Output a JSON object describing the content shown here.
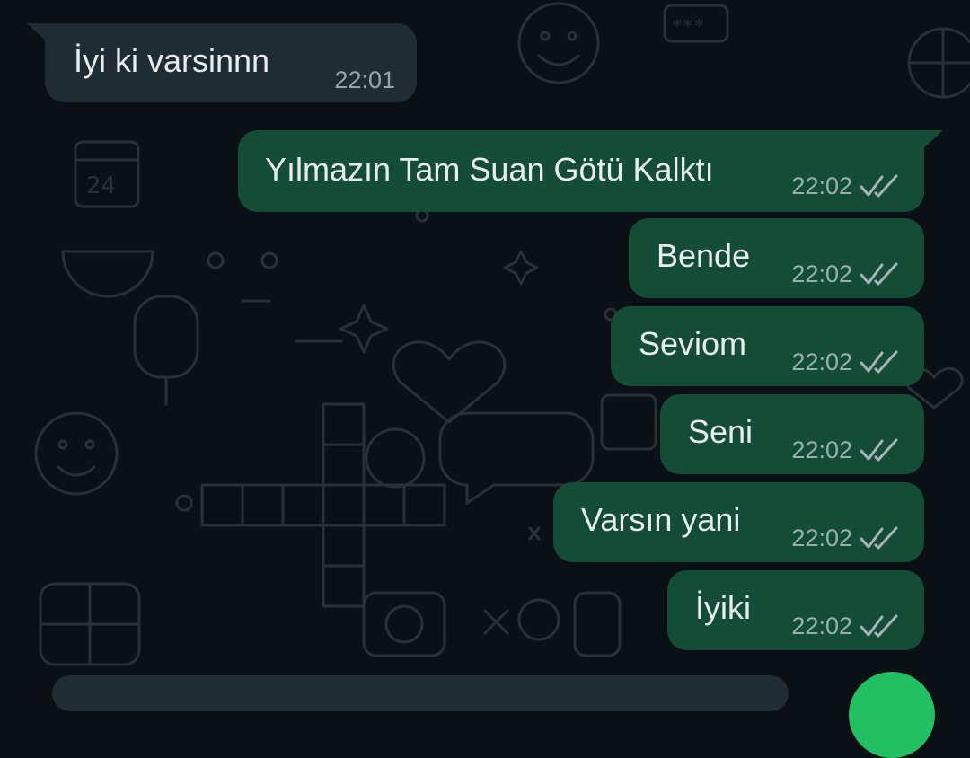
{
  "chat": {
    "messages": [
      {
        "direction": "incoming",
        "text": "İyi ki varsinnn",
        "time": "22:01"
      },
      {
        "direction": "outgoing",
        "text": "Yılmazın Tam Suan Götü Kalktı",
        "time": "22:02",
        "status": "read"
      },
      {
        "direction": "outgoing",
        "text": "Bende",
        "time": "22:02",
        "status": "read"
      },
      {
        "direction": "outgoing",
        "text": "Seviom",
        "time": "22:02",
        "status": "read"
      },
      {
        "direction": "outgoing",
        "text": "Seni",
        "time": "22:02",
        "status": "read"
      },
      {
        "direction": "outgoing",
        "text": "Varsın yani",
        "time": "22:02",
        "status": "read"
      },
      {
        "direction": "outgoing",
        "text": "İyiki",
        "time": "22:02",
        "status": "read"
      }
    ]
  },
  "theme": {
    "background": "#0b1014",
    "incoming_bubble": "#202c33",
    "outgoing_bubble": "#144d37",
    "text": "#e9edef",
    "send_button": "#21c063"
  },
  "icons": {
    "read_receipt": "double-check-icon",
    "send": "send-button"
  }
}
